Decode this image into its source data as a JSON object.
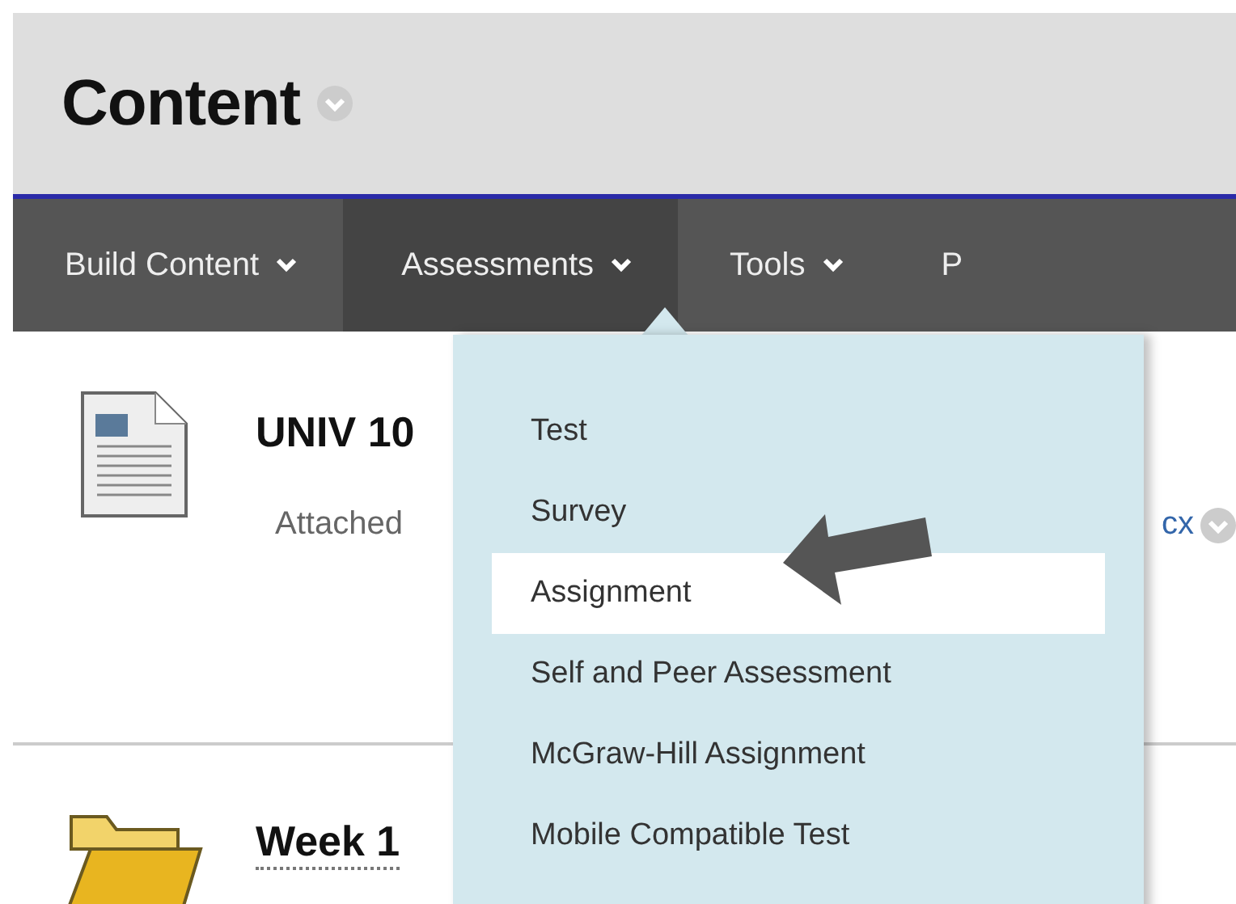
{
  "header": {
    "title": "Content"
  },
  "nav": [
    {
      "label": "Build Content",
      "selected": false,
      "caret": true
    },
    {
      "label": "Assessments",
      "selected": true,
      "caret": true
    },
    {
      "label": "Tools",
      "selected": false,
      "caret": true
    },
    {
      "label": "P",
      "selected": false,
      "caret": false
    }
  ],
  "menu": {
    "items": [
      {
        "label": "Test",
        "selected": false
      },
      {
        "label": "Survey",
        "selected": false
      },
      {
        "label": "Assignment",
        "selected": true
      },
      {
        "label": "Self and Peer Assessment",
        "selected": false
      },
      {
        "label": "McGraw-Hill Assignment",
        "selected": false
      },
      {
        "label": "Mobile Compatible Test",
        "selected": false
      }
    ]
  },
  "items": [
    {
      "kind": "document",
      "title": "UNIV 10",
      "subtitle": "Attached",
      "file": "cx"
    },
    {
      "kind": "folder",
      "title": "Week 1"
    }
  ]
}
